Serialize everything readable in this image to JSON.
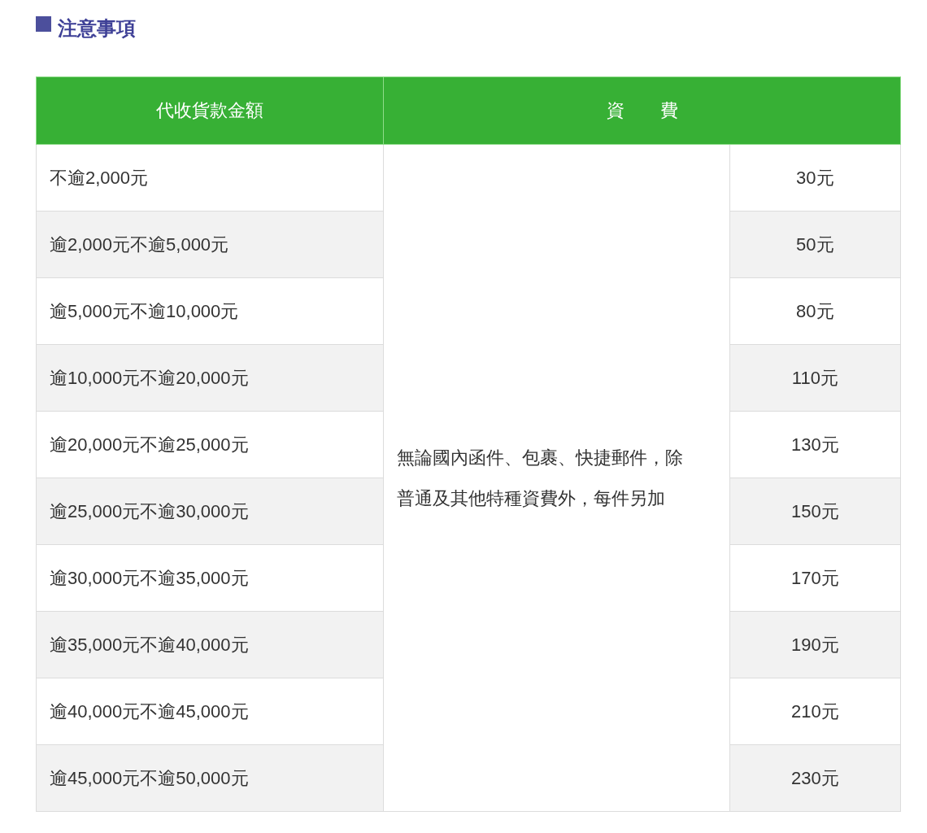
{
  "heading": {
    "title": "注意事項"
  },
  "table": {
    "columns": [
      {
        "label": "代收貨款金額"
      },
      {
        "label": "資　　費"
      }
    ],
    "note": "無論國內函件、包裹、快捷郵件，除普通及其他特種資費外，每件另加",
    "rows": [
      {
        "amount": "不逾2,000元",
        "fee": "30元"
      },
      {
        "amount": "逾2,000元不逾5,000元",
        "fee": "50元"
      },
      {
        "amount": "逾5,000元不逾10,000元",
        "fee": "80元"
      },
      {
        "amount": "逾10,000元不逾20,000元",
        "fee": "110元"
      },
      {
        "amount": "逾20,000元不逾25,000元",
        "fee": "130元"
      },
      {
        "amount": "逾25,000元不逾30,000元",
        "fee": "150元"
      },
      {
        "amount": "逾30,000元不逾35,000元",
        "fee": "170元"
      },
      {
        "amount": "逾35,000元不逾40,000元",
        "fee": "190元"
      },
      {
        "amount": "逾40,000元不逾45,000元",
        "fee": "210元"
      },
      {
        "amount": "逾45,000元不逾50,000元",
        "fee": "230元"
      }
    ]
  }
}
